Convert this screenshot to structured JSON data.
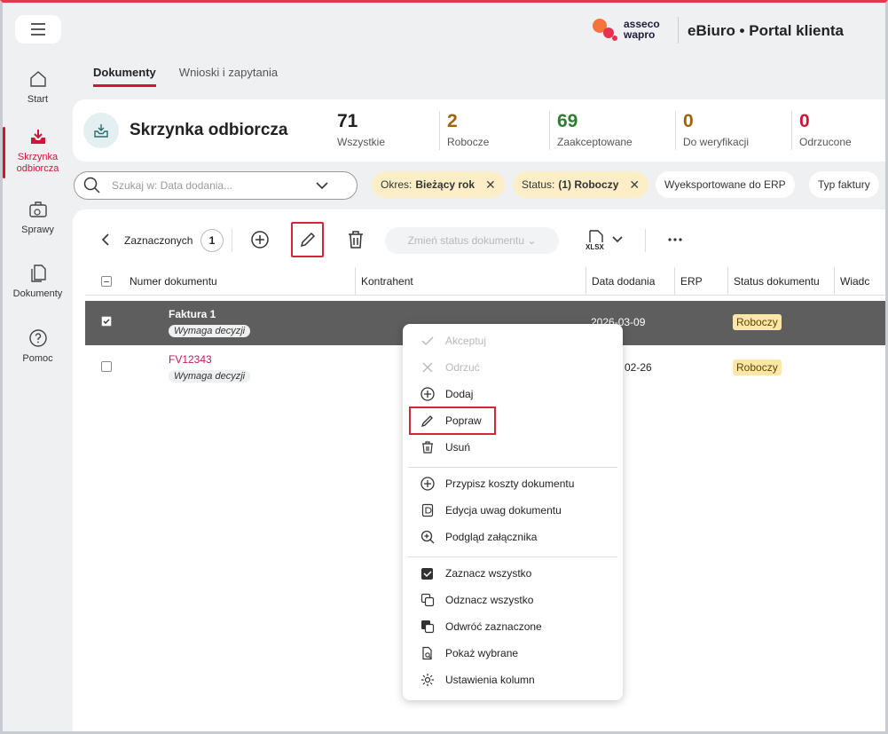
{
  "header": {
    "logo_line1": "asseco",
    "logo_line2": "wapro",
    "title": "eBiuro • Portal klienta"
  },
  "sidebar": {
    "items": [
      {
        "label": "Start"
      },
      {
        "label": "Skrzynka odbiorcza"
      },
      {
        "label": "Sprawy"
      },
      {
        "label": "Dokumenty"
      },
      {
        "label": "Pomoc"
      }
    ]
  },
  "tabs": [
    {
      "label": "Dokumenty"
    },
    {
      "label": "Wnioski i zapytania"
    }
  ],
  "summary": {
    "title": "Skrzynka odbiorcza",
    "stats": [
      {
        "value": "71",
        "label": "Wszystkie",
        "color": "#222222"
      },
      {
        "value": "2",
        "label": "Robocze",
        "color": "#a0620a"
      },
      {
        "value": "69",
        "label": "Zaakceptowane",
        "color": "#2e7d32"
      },
      {
        "value": "0",
        "label": "Do weryfikacji",
        "color": "#a0620a"
      },
      {
        "value": "0",
        "label": "Odrzucone",
        "color": "#d1153a"
      }
    ]
  },
  "filters": {
    "search_placeholder": "Szukaj w: Data dodania...",
    "chips": [
      {
        "key": "Okres:",
        "value": "Bieżący rok"
      },
      {
        "key": "Status:",
        "value": "(1) Roboczy"
      },
      {
        "label": "Wyeksportowane do ERP"
      },
      {
        "label": "Typ faktury"
      }
    ]
  },
  "toolbar": {
    "selected_label": "Zaznaczonych",
    "selected_count": "1",
    "change_status": "Zmień status dokumentu",
    "export_format": "XLSX"
  },
  "table": {
    "columns": [
      "Numer dokumentu",
      "Kontrahent",
      "Data dodania",
      "ERP",
      "Status dokumentu",
      "Wiadc"
    ],
    "rows": [
      {
        "number": "Faktura 1",
        "tag": "Wymaga decyzji",
        "date": "2026-03-09",
        "status": "Roboczy"
      },
      {
        "number": "FV12343",
        "tag": "Wymaga decyzji",
        "date": "02-26",
        "status": "Roboczy"
      }
    ]
  },
  "context_menu": {
    "items": [
      "Akceptuj",
      "Odrzuć",
      "Dodaj",
      "Popraw",
      "Usuń",
      "Przypisz koszty dokumentu",
      "Edycja uwag dokumentu",
      "Podgląd załącznika",
      "Zaznacz wszystko",
      "Odznacz wszystko",
      "Odwróć zaznaczone",
      "Pokaż wybrane",
      "Ustawienia kolumn"
    ]
  },
  "colors": {
    "accent": "#d1153a",
    "status_draft_bg": "#fde7a8",
    "selected_row": "#5e5e5e"
  }
}
